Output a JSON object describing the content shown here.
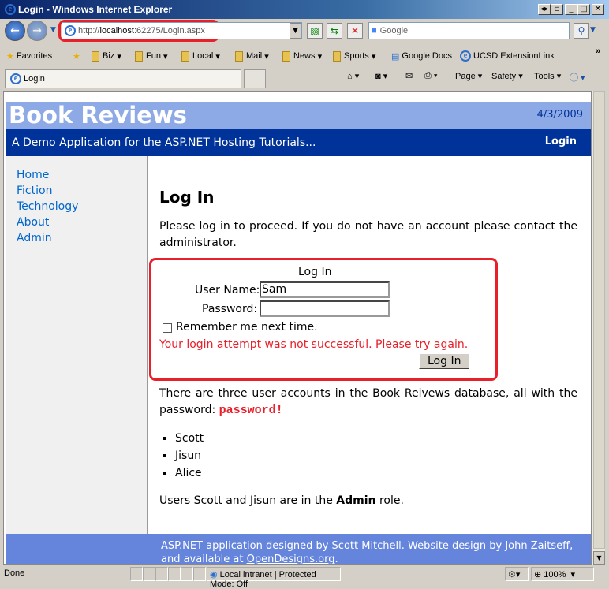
{
  "window": {
    "title": "Login - Windows Internet Explorer"
  },
  "address": {
    "url_prefix": "http://",
    "url_host": "localhost",
    "url_rest": ":62275/Login.aspx"
  },
  "search": {
    "placeholder": "Google"
  },
  "favorites": {
    "label": "Favorites",
    "items": [
      "Biz",
      "Fun",
      "Local",
      "Mail",
      "News",
      "Sports"
    ],
    "links": [
      "Google Docs",
      "UCSD ExtensionLink"
    ]
  },
  "tab": {
    "label": "Login"
  },
  "commands": {
    "page": "Page",
    "safety": "Safety",
    "tools": "Tools"
  },
  "site": {
    "brand": "Book Reviews",
    "date": "4/3/2009",
    "subtitle": "A Demo Application for the ASP.NET Hosting Tutorials...",
    "login_link": "Login"
  },
  "sidebar": {
    "items": [
      "Home",
      "Fiction",
      "Technology",
      "About",
      "Admin"
    ]
  },
  "main": {
    "heading": "Log In",
    "intro": "Please log in to proceed. If you do not have an account please contact the administrator.",
    "login": {
      "title": "Log In",
      "username_label": "User Name:",
      "username_value": "Sam",
      "password_label": "Password:",
      "remember_label": "Remember me next time.",
      "error": "Your login attempt was not successful. Please try again.",
      "button": "Log In"
    },
    "accounts_text": "There are three user accounts in the Book Reivews database, all with the password:",
    "password": "password!",
    "users": [
      "Scott",
      "Jisun",
      "Alice"
    ],
    "roles_pre": "Users Scott and Jisun are in the",
    "roles_bold": "Admin",
    "roles_post": "role."
  },
  "footer": {
    "t1": "ASP.NET application designed by",
    "link1": "Scott Mitchell",
    "t2": ". Website design by",
    "link2": "John Zaitseff",
    "t3": ", and available at",
    "link3": "OpenDesigns.org",
    "t4": "."
  },
  "status": {
    "text": "Done",
    "zone": "Local intranet | Protected Mode: Off",
    "zoom": "100%"
  }
}
